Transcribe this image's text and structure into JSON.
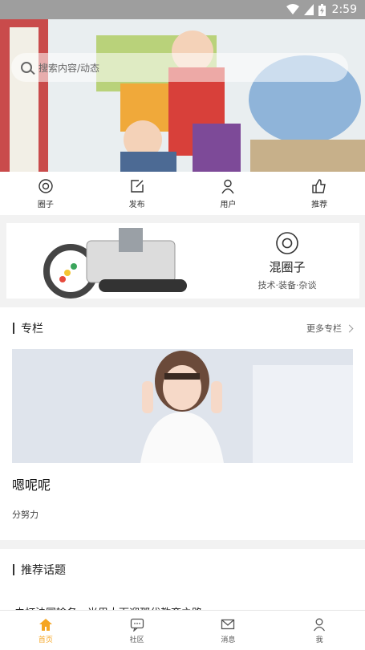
{
  "status_bar": {
    "time": "2:59"
  },
  "search": {
    "placeholder": "搜索内容/动态"
  },
  "quick_nav": [
    {
      "label": "圈子",
      "icon": "circle-target-icon"
    },
    {
      "label": "发布",
      "icon": "edit-icon"
    },
    {
      "label": "用户",
      "icon": "user-icon"
    },
    {
      "label": "推荐",
      "icon": "thumbs-up-icon"
    }
  ],
  "promo": {
    "title": "混圈子",
    "subtitle": "技术·装备·杂谈",
    "icon": "circle-target-icon"
  },
  "column_section": {
    "title": "专栏",
    "more_label": "更多专栏",
    "article": {
      "title": "嗯呢呢",
      "subtitle": "分努力"
    }
  },
  "topics_section": {
    "title": "推荐话题",
    "preview_text": "去打法国输务，当里大面迎那代教育之路"
  },
  "tabs": [
    {
      "label": "首页",
      "icon": "home-icon",
      "active": true
    },
    {
      "label": "社区",
      "icon": "chat-bubble-icon",
      "active": false
    },
    {
      "label": "消息",
      "icon": "mail-icon",
      "active": false
    },
    {
      "label": "我",
      "icon": "person-icon",
      "active": false
    }
  ],
  "colors": {
    "accent": "#f5a623",
    "status_bar": "#9e9e9e"
  }
}
